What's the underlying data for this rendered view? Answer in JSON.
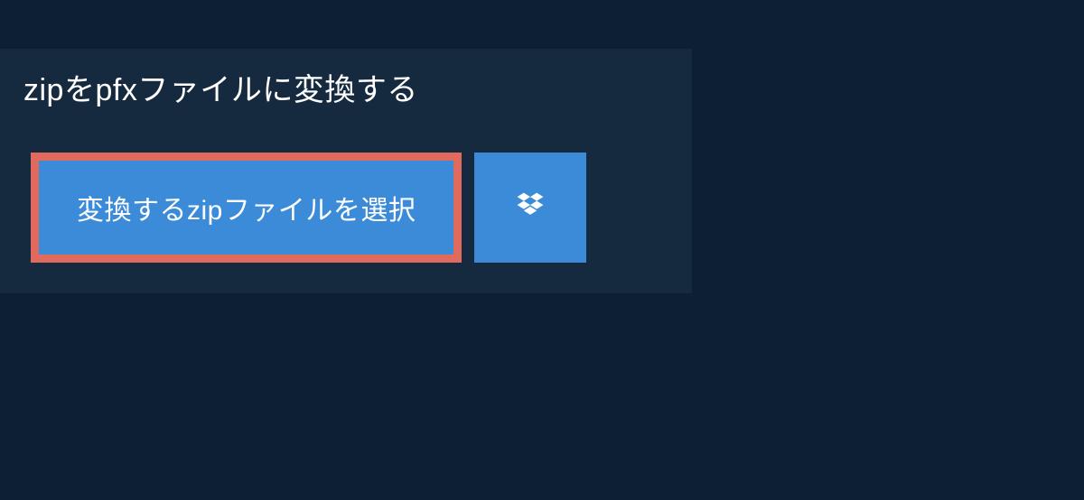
{
  "header": {
    "title": "zipをpfxファイルに変換する"
  },
  "actions": {
    "select_file_label": "変換するzipファイルを選択",
    "dropbox_icon": "dropbox"
  },
  "colors": {
    "page_bg": "#0d1f33",
    "panel_bg": "#15293f",
    "button_bg": "#3b8bd8",
    "highlight_border": "#e06a5e",
    "text": "#ffffff"
  }
}
